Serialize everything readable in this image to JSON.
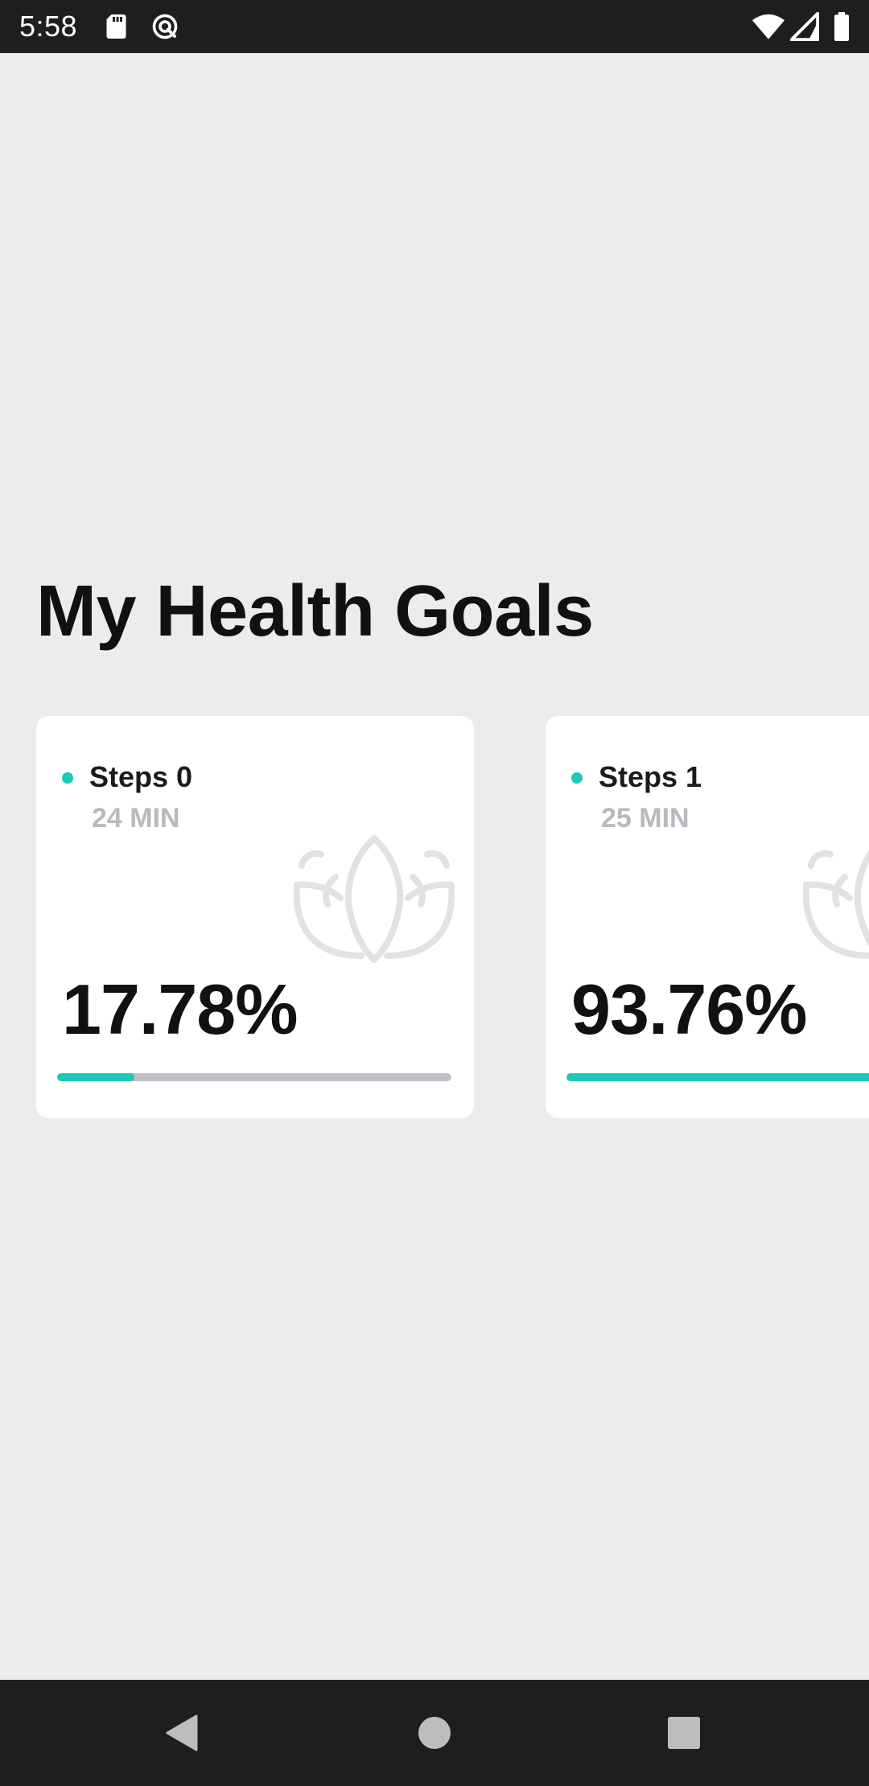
{
  "status_bar": {
    "time": "5:58",
    "left_icons": [
      "sd-card-icon",
      "vpn-key-icon"
    ],
    "right_icons": [
      "wifi-icon",
      "cell-signal-icon",
      "battery-icon"
    ]
  },
  "page": {
    "title": "My Health Goals"
  },
  "goals": [
    {
      "name": "Steps 0",
      "duration": "24 MIN",
      "percent_text": "17.78%",
      "progress": 0.1778
    },
    {
      "name": "Steps 1",
      "duration": "25 MIN",
      "percent_text": "93.76%",
      "progress": 0.9376
    }
  ],
  "navigation": {
    "buttons": [
      "back-icon",
      "home-icon",
      "recents-icon"
    ]
  },
  "colors": {
    "accent": "#1ccab3",
    "background": "#ececec",
    "card": "#ffffff",
    "track": "#c0c0c6",
    "system_bars": "#1e1e1e"
  }
}
